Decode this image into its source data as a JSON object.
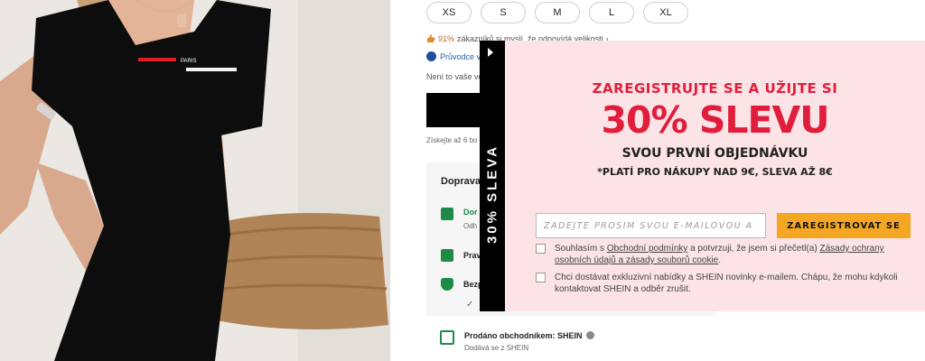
{
  "product": {
    "shirt_text": "PARIS",
    "sizes": [
      "XS",
      "S",
      "M",
      "L",
      "XL"
    ],
    "fit_percent": "91%",
    "fit_text": "zákazníků si myslí, že odpovídá velikosti",
    "fit_chevron": "›",
    "size_guide": "Průvodce v",
    "not_your_size": "Není to vaše ve",
    "points_text": "Získejte až 6 bo"
  },
  "delivery": {
    "title": "Doprava",
    "shipping_label": "Dor",
    "shipping_sub": "Odh",
    "returns_label": "Prav",
    "security_label": "Bezp",
    "check_mark": "✓"
  },
  "seller": {
    "sold_by": "Prodáno obchodníkem: SHEIN",
    "ships_from": "Dodává se z SHEIN"
  },
  "popup": {
    "side_tab": "30% SLEVA",
    "headline_1": "ZAREGISTRUJTE SE A UŽIJTE SI",
    "headline_2": "30% SLEVU",
    "headline_3": "SVOU PRVNÍ OBJEDNÁVKU",
    "headline_4": "*PLATÍ PRO NÁKUPY NAD 9€, SLEVA AŽ 8€",
    "email_placeholder": "ZADEJTE PROSÍM SVOU E-MAILOVOU A",
    "register_button": "ZAREGISTROVAT SE",
    "consent_1_pre": "Souhlasím s ",
    "consent_1_link1": "Obchodní podmínky",
    "consent_1_mid": " a potvrzuji, že jsem si přečetl(a) ",
    "consent_1_link2": "Zásady ochrany osobních údajů a zásady souborů cookie",
    "consent_1_post": ".",
    "consent_2": "Chci dostávat exkluzivní nabídky a SHEIN novinky e-mailem. Chápu, že mohu kdykoli kontaktovat SHEIN a odběr zrušit."
  },
  "colors": {
    "accent_red": "#e01e3c",
    "button_orange": "#f5a623",
    "popup_bg": "#fce3e5",
    "green": "#1e8a4a"
  },
  "icons": [
    "thumbs-up-icon",
    "size-guide-icon",
    "truck-icon",
    "return-icon",
    "shield-icon",
    "check-icon",
    "store-icon",
    "info-icon",
    "play-arrow-icon"
  ]
}
